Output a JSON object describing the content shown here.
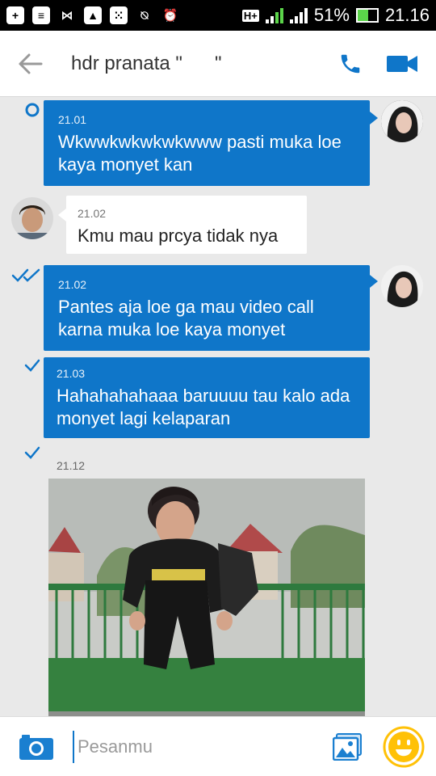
{
  "status_bar": {
    "network": "H+",
    "battery": "51%",
    "clock": "21.16"
  },
  "header": {
    "title": "hdr pranata \"      \""
  },
  "messages": [
    {
      "time": "21.01",
      "text": "Wkwwkwkwkwkwww pasti muka loe kaya monyet kan"
    },
    {
      "time": "21.02",
      "text": "Kmu mau prcya tidak nya"
    },
    {
      "time": "21.02",
      "text": "Pantes aja loe ga mau video call karna muka loe kaya monyet"
    },
    {
      "time": "21.03",
      "text": "Hahahahahaaa baruuuu tau kalo ada monyet lagi kelaparan"
    },
    {
      "time": "21.12"
    }
  ],
  "input": {
    "placeholder": "Pesanmu"
  },
  "colors": {
    "accent": "#0f76c9",
    "emoji": "#ffc107"
  }
}
